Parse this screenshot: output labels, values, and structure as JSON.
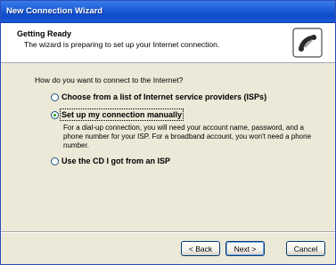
{
  "window": {
    "title": "New Connection Wizard"
  },
  "header": {
    "title": "Getting Ready",
    "subtitle": "The wizard is preparing to set up your Internet connection.",
    "icon": "phone-modem-icon"
  },
  "content": {
    "question": "How do you want to connect to the Internet?",
    "options": [
      {
        "label": "Choose from a list of Internet service providers (ISPs)",
        "selected": false,
        "description": ""
      },
      {
        "label": "Set up my connection manually",
        "selected": true,
        "description": "For a dial-up connection, you will need your account name, password, and a phone number for your ISP. For a broadband account, you won't need a phone number."
      },
      {
        "label": "Use the CD I got from an ISP",
        "selected": false,
        "description": ""
      }
    ]
  },
  "buttons": {
    "back": "< Back",
    "next": "Next >",
    "cancel": "Cancel"
  },
  "colors": {
    "titlebar": "#1f5fd8",
    "dialog_bg": "#ece9d8",
    "radio_check": "#21a121"
  }
}
